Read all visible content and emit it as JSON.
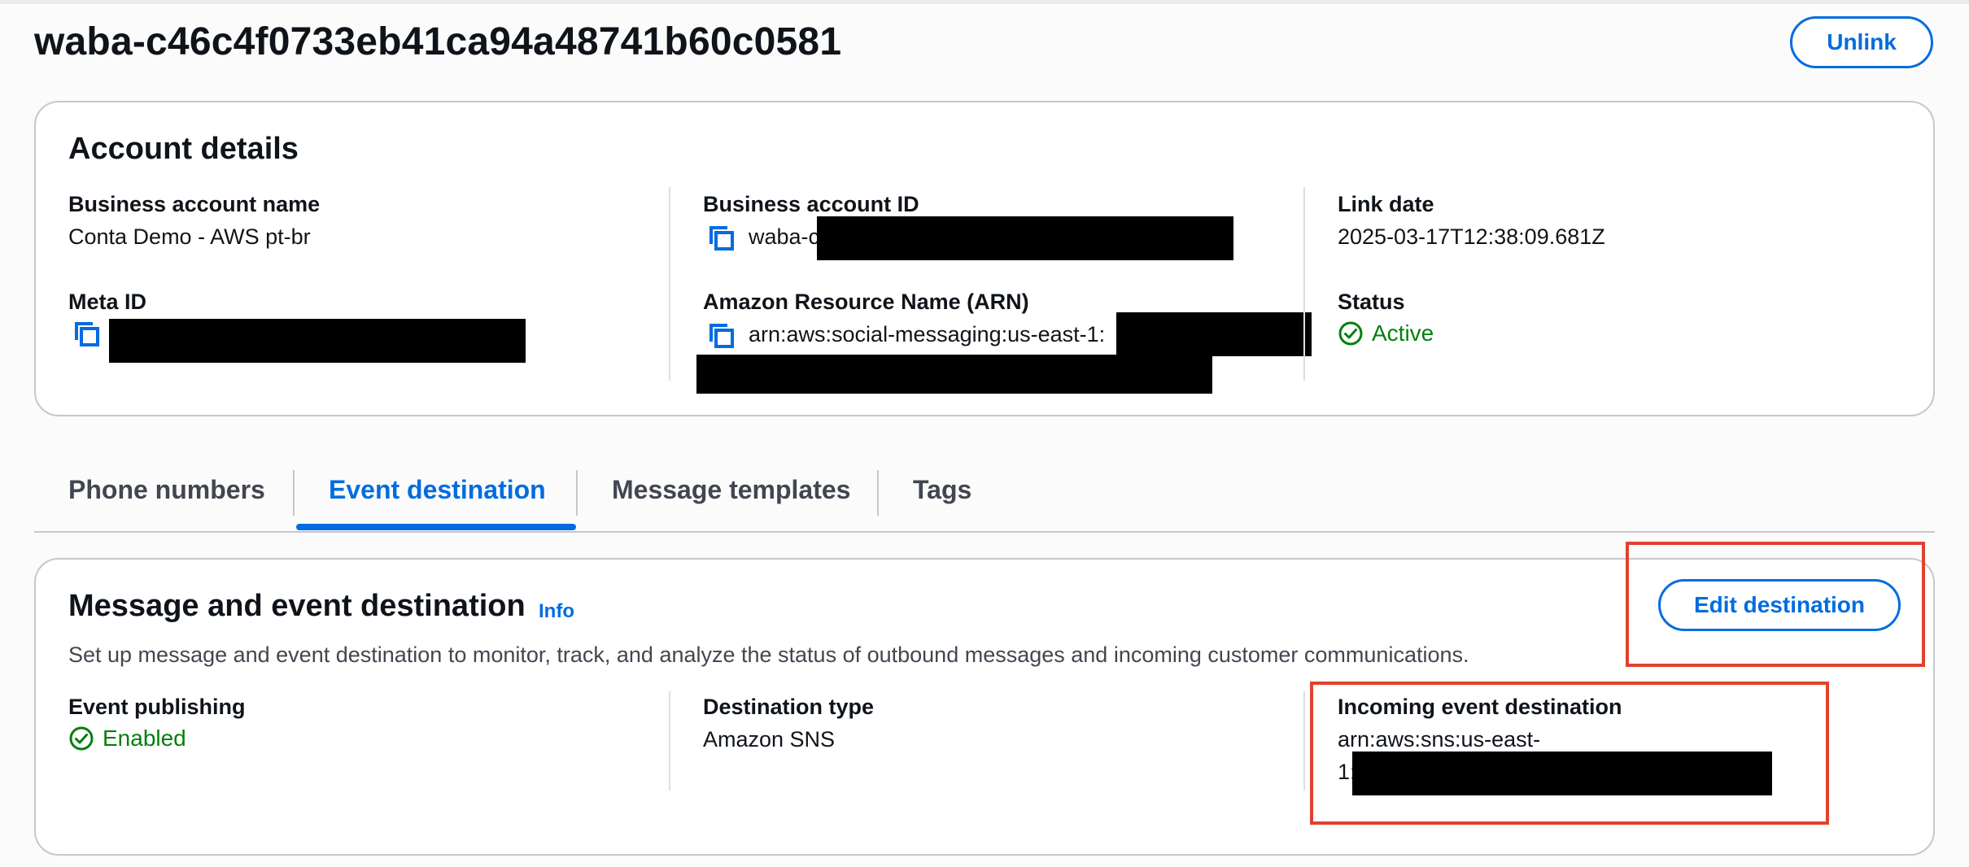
{
  "page": {
    "title": "waba-c46c4f0733eb41ca94a48741b60c0581",
    "unlink_label": "Unlink"
  },
  "account": {
    "heading": "Account details",
    "business_account_name": {
      "label": "Business account name",
      "value": "Conta Demo - AWS pt-br"
    },
    "meta_id": {
      "label": "Meta ID"
    },
    "business_account_id": {
      "label": "Business account ID",
      "value": "waba-c"
    },
    "arn": {
      "label": "Amazon Resource Name (ARN)",
      "value": "arn:aws:social-messaging:us-east-1:"
    },
    "link_date": {
      "label": "Link date",
      "value": "2025-03-17T12:38:09.681Z"
    },
    "status": {
      "label": "Status",
      "value": "Active"
    }
  },
  "tabs": [
    {
      "label": "Phone numbers",
      "active": false
    },
    {
      "label": "Event destination",
      "active": true
    },
    {
      "label": "Message templates",
      "active": false
    },
    {
      "label": "Tags",
      "active": false
    }
  ],
  "destination": {
    "heading": "Message and event destination",
    "info_label": "Info",
    "edit_label": "Edit destination",
    "description": "Set up message and event destination to monitor, track, and analyze the status of outbound messages and incoming customer communications.",
    "event_publishing": {
      "label": "Event publishing",
      "value": "Enabled"
    },
    "destination_type": {
      "label": "Destination type",
      "value": "Amazon SNS"
    },
    "incoming": {
      "label": "Incoming event destination",
      "value_line1": "arn:aws:sns:us-east-",
      "value_line2": "1:"
    }
  },
  "colors": {
    "accent": "#006ce0",
    "success": "#037f0c",
    "highlight": "#e0422d"
  },
  "icons": [
    "copy-icon",
    "check-circle-icon"
  ]
}
